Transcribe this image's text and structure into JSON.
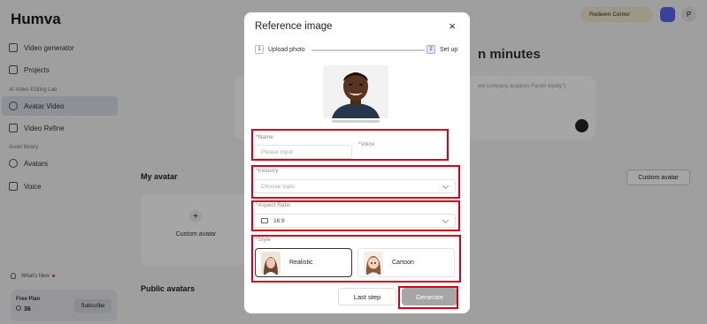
{
  "app": {
    "logo": "Humva",
    "sidebar": [
      {
        "label": "Video generator"
      },
      {
        "label": "Projects"
      },
      {
        "label": "Avatar Video"
      },
      {
        "label": "Video Refine"
      },
      {
        "label": "Avatars"
      },
      {
        "label": "Voice"
      }
    ],
    "section_lab": "AI Video Editing Lab",
    "section_asset": "Asset library",
    "whats_new": "What's New",
    "plan": {
      "name": "Free Plan",
      "credits": "36",
      "subscribe": "Subscribe"
    },
    "redeem": "Redeem Center",
    "user_initial": "P",
    "hero_partial": "n minutes",
    "prompt_placeholder": "ent company acquires Factor equity\")",
    "my_avatar": "My avatar",
    "custom_avatar_button": "Custom avatar",
    "custom_avatar_card": "Custom avatar",
    "public_avatars": "Public avatars"
  },
  "modal": {
    "title": "Reference image",
    "close": "×",
    "steps": [
      {
        "num": "1",
        "label": "Upload photo"
      },
      {
        "num": "2",
        "label": "Set up"
      }
    ],
    "name_label": "*Name",
    "name_placeholder": "Please input",
    "voice_label": "*Voice",
    "industry_label": "*Industry",
    "industry_placeholder": "Choose topic",
    "ratio_label": "*Aspect Ratio",
    "ratio_value": "16:9",
    "style_label": "*Style",
    "styles": [
      {
        "label": "Realistic",
        "selected": true
      },
      {
        "label": "Cartoon",
        "selected": false
      }
    ],
    "last_step": "Last step",
    "generate": "Generate"
  }
}
